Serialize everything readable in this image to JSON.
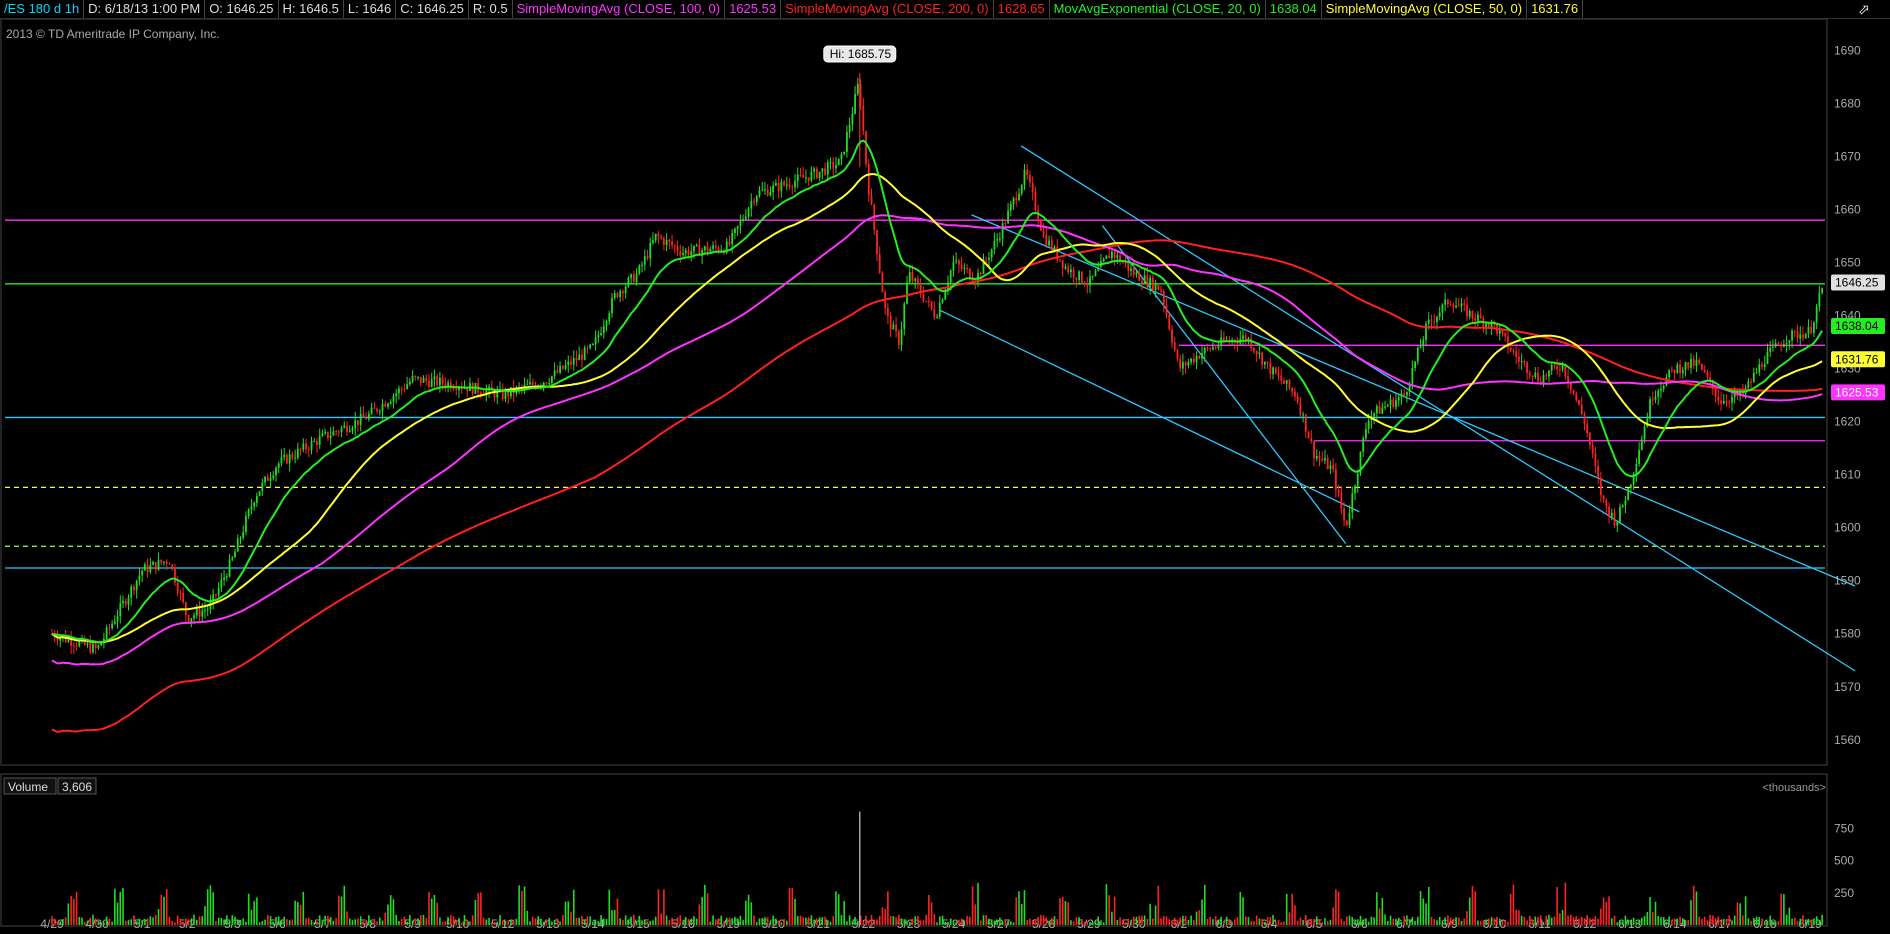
{
  "header": {
    "symbol": "/ES 180 d 1h",
    "date": "D: 6/18/13 1:00 PM",
    "open": "O: 1646.25",
    "high": "H: 1646.5",
    "low": "L: 1646",
    "close": "C: 1646.25",
    "range": "R: 0.5",
    "studies": [
      {
        "label": "SimpleMovingAvg (CLOSE, 100, 0)",
        "value": "1625.53",
        "color": "#ff33ff"
      },
      {
        "label": "SimpleMovingAvg (CLOSE, 200, 0)",
        "value": "1628.65",
        "color": "#ff2020"
      },
      {
        "label": "MovAvgExponential (CLOSE, 20, 0)",
        "value": "1638.04",
        "color": "#22ee22"
      },
      {
        "label": "SimpleMovingAvg (CLOSE, 50, 0)",
        "value": "1631.76",
        "color": "#ffff33"
      }
    ]
  },
  "copyright": "2013 © TD Ameritrade IP Company, Inc.",
  "hi_label": "Hi: 1685.75",
  "last_price": "1646.25",
  "volume": {
    "label": "Volume",
    "value": "3,606",
    "units": "<thousands>"
  },
  "chart_data": {
    "type": "candlestick",
    "y_ticks": [
      1560,
      1570,
      1580,
      1590,
      1600,
      1610,
      1620,
      1630,
      1640,
      1650,
      1660,
      1670,
      1680,
      1690
    ],
    "ylim": [
      1556,
      1695
    ],
    "x_labels": [
      "4/29",
      "4/30",
      "5/1",
      "5/2",
      "5/3",
      "5/6",
      "5/7",
      "5/8",
      "5/9",
      "5/10",
      "5/12",
      "5/13",
      "5/14",
      "5/15",
      "5/16",
      "5/19",
      "5/20",
      "5/21",
      "5/22",
      "5/23",
      "5/24",
      "5/27",
      "5/28",
      "5/29",
      "5/30",
      "6/2",
      "6/3",
      "6/4",
      "6/5",
      "6/6",
      "6/7",
      "6/9",
      "6/10",
      "6/11",
      "6/12",
      "6/13",
      "6/14",
      "6/17",
      "6/18",
      "6/19"
    ],
    "price_path": [
      [
        0,
        1580
      ],
      [
        1,
        1577
      ],
      [
        2,
        1592
      ],
      [
        2.6,
        1594
      ],
      [
        3,
        1583
      ],
      [
        3.5,
        1585
      ],
      [
        4,
        1594
      ],
      [
        4.5,
        1606
      ],
      [
        5,
        1612
      ],
      [
        6,
        1617
      ],
      [
        7,
        1621
      ],
      [
        8,
        1628
      ],
      [
        9,
        1627
      ],
      [
        10,
        1625
      ],
      [
        11,
        1628
      ],
      [
        12,
        1634
      ],
      [
        12.5,
        1644
      ],
      [
        13,
        1648
      ],
      [
        13.4,
        1655
      ],
      [
        14,
        1652
      ],
      [
        15,
        1653
      ],
      [
        15.6,
        1663
      ],
      [
        16,
        1664
      ],
      [
        17,
        1667
      ],
      [
        17.5,
        1669
      ],
      [
        17.9,
        1684
      ],
      [
        18.1,
        1665
      ],
      [
        18.5,
        1640
      ],
      [
        18.8,
        1635
      ],
      [
        19,
        1648
      ],
      [
        19.6,
        1640
      ],
      [
        20,
        1650
      ],
      [
        20.5,
        1647
      ],
      [
        21,
        1655
      ],
      [
        21.6,
        1667
      ],
      [
        22,
        1655
      ],
      [
        22.5,
        1649
      ],
      [
        23,
        1646
      ],
      [
        23.5,
        1652
      ],
      [
        24,
        1648
      ],
      [
        24.6,
        1645
      ],
      [
        25,
        1630
      ],
      [
        25.5,
        1633
      ],
      [
        26,
        1635
      ],
      [
        26.5,
        1636
      ],
      [
        27,
        1630
      ],
      [
        27.6,
        1625
      ],
      [
        28,
        1614
      ],
      [
        28.4,
        1611
      ],
      [
        28.7,
        1600
      ],
      [
        29.2,
        1621
      ],
      [
        30,
        1625
      ],
      [
        30.5,
        1638
      ],
      [
        31,
        1643
      ],
      [
        31.5,
        1640
      ],
      [
        32,
        1638
      ],
      [
        32.5,
        1632
      ],
      [
        33,
        1628
      ],
      [
        33.5,
        1631
      ],
      [
        34,
        1620
      ],
      [
        34.4,
        1605
      ],
      [
        34.7,
        1601
      ],
      [
        35,
        1608
      ],
      [
        35.5,
        1625
      ],
      [
        36,
        1630
      ],
      [
        36.5,
        1631
      ],
      [
        37,
        1624
      ],
      [
        37.5,
        1625
      ],
      [
        38,
        1632
      ],
      [
        38.5,
        1636
      ],
      [
        39,
        1637
      ],
      [
        39.3,
        1646
      ]
    ],
    "sma100_last": 1625.53,
    "sma200_last": 1628.65,
    "ema20_last": 1638.04,
    "sma50_last": 1631.76,
    "hi": 1685.75,
    "horizontal_lines": [
      {
        "y": 1658,
        "color": "#ff33ff",
        "style": "solid"
      },
      {
        "y": 1646,
        "color": "#22ee22",
        "style": "solid"
      },
      {
        "y": 1620.8,
        "color": "#2ec8ff",
        "style": "solid"
      },
      {
        "y": 1607.6,
        "color": "#ffff33",
        "style": "dashed"
      },
      {
        "y": 1596.5,
        "color": "#aaff33",
        "style": "dashed"
      },
      {
        "y": 1592.4,
        "color": "#2ec8ff",
        "style": "solid"
      },
      {
        "y": 1634.4,
        "color": "#ff33ff",
        "style": "solid",
        "x_start": 25
      },
      {
        "y": 1616.4,
        "color": "#ff33ff",
        "style": "solid",
        "x_start": 28
      }
    ],
    "volume_ticks": [
      250,
      500,
      750
    ]
  }
}
